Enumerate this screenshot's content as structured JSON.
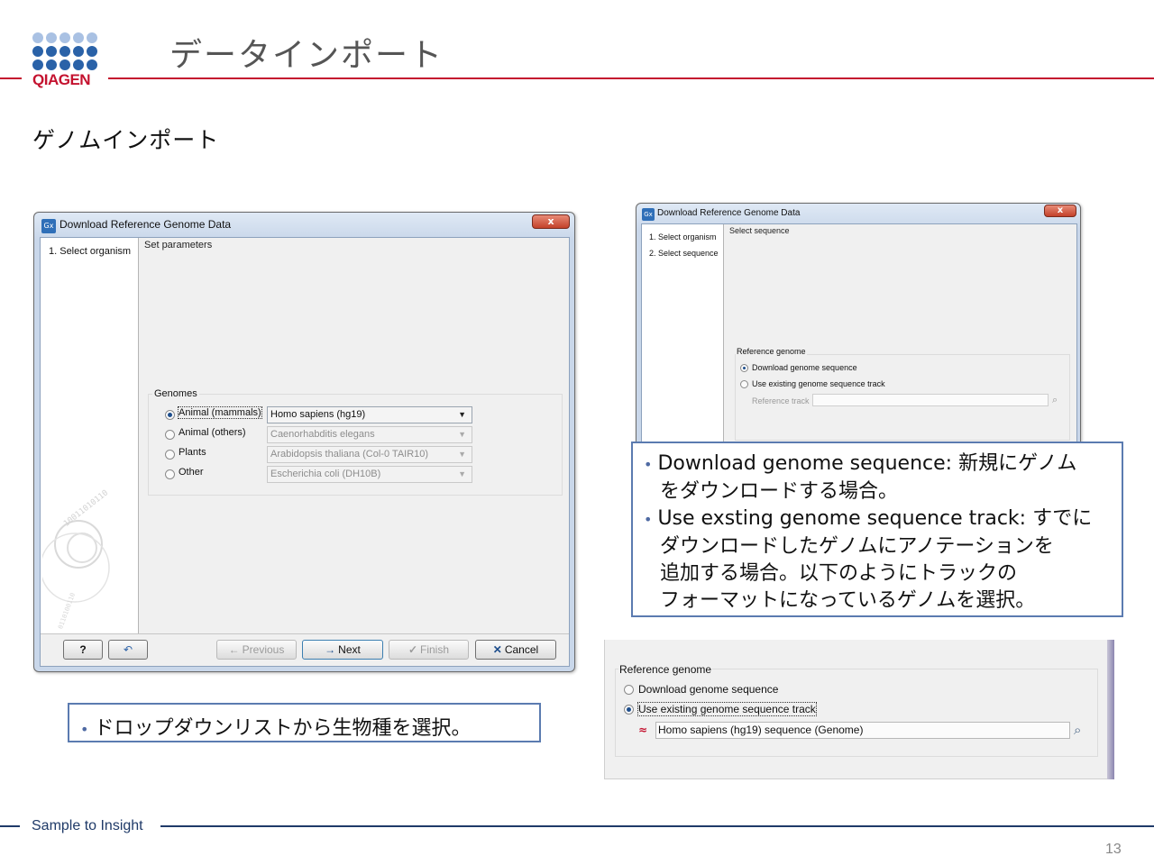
{
  "header": {
    "brand": "QIAGEN",
    "title": "データインポート",
    "subtitle": "ゲノムインポート"
  },
  "colors": {
    "brand_red": "#c4122f",
    "footer_blue": "#1f3a68",
    "logo_blue": "#2a62a8",
    "logo_light": "#a9c1e3"
  },
  "dialog1": {
    "icon": "Gx",
    "title": "Download Reference Genome Data",
    "close": "x",
    "steps": [
      "1. Select organism"
    ],
    "panel_title": "Set parameters",
    "group_title": "Genomes",
    "rows": [
      {
        "label": "Animal (mammals)",
        "value": "Homo sapiens (hg19)",
        "selected": true
      },
      {
        "label": "Animal (others)",
        "value": "Caenorhabditis elegans",
        "selected": false
      },
      {
        "label": "Plants",
        "value": "Arabidopsis thaliana (Col-0 TAIR10)",
        "selected": false
      },
      {
        "label": "Other",
        "value": "Escherichia coli (DH10B)",
        "selected": false
      }
    ],
    "buttons": {
      "help": "?",
      "reset_icon": "↶",
      "previous": "Previous",
      "next": "Next",
      "finish": "Finish",
      "cancel": "Cancel"
    }
  },
  "dialog2": {
    "icon": "Gx",
    "title": "Download Reference Genome Data",
    "close": "x",
    "steps": [
      "1. Select organism",
      "2. Select sequence"
    ],
    "panel_title": "Select sequence",
    "group_title": "Reference genome",
    "options": [
      "Download genome sequence",
      "Use existing genome sequence track"
    ],
    "selected_index": 0,
    "track_label": "Reference track",
    "track_value": ""
  },
  "panel3": {
    "group_title": "Reference genome",
    "options": [
      "Download genome sequence",
      "Use existing genome sequence track"
    ],
    "selected_index": 1,
    "track_value": "Homo sapiens (hg19) sequence (Genome)"
  },
  "callout_right": {
    "items": [
      {
        "lines": [
          "Download genome sequence: 新規にゲノム",
          "をダウンロードする場合。"
        ]
      },
      {
        "lines": [
          "Use exsting genome sequence track: すでに",
          "ダウンロードしたゲノムにアノテーションを",
          "追加する場合。以下のようにトラックの",
          "フォーマットになっているゲノムを選択。"
        ]
      }
    ]
  },
  "callout_left": {
    "text": "ドロップダウンリストから生物種を選択。"
  },
  "footer": {
    "tagline": "Sample to Insight",
    "page": "13"
  }
}
